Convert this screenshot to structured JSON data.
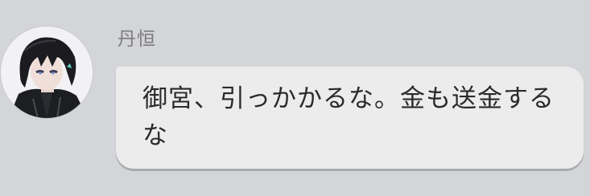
{
  "message": {
    "sender": "丹恒",
    "text": "御宮、引っかかるな。金も送金するな"
  },
  "avatar": {
    "icon": "character-avatar-dark-hair"
  }
}
